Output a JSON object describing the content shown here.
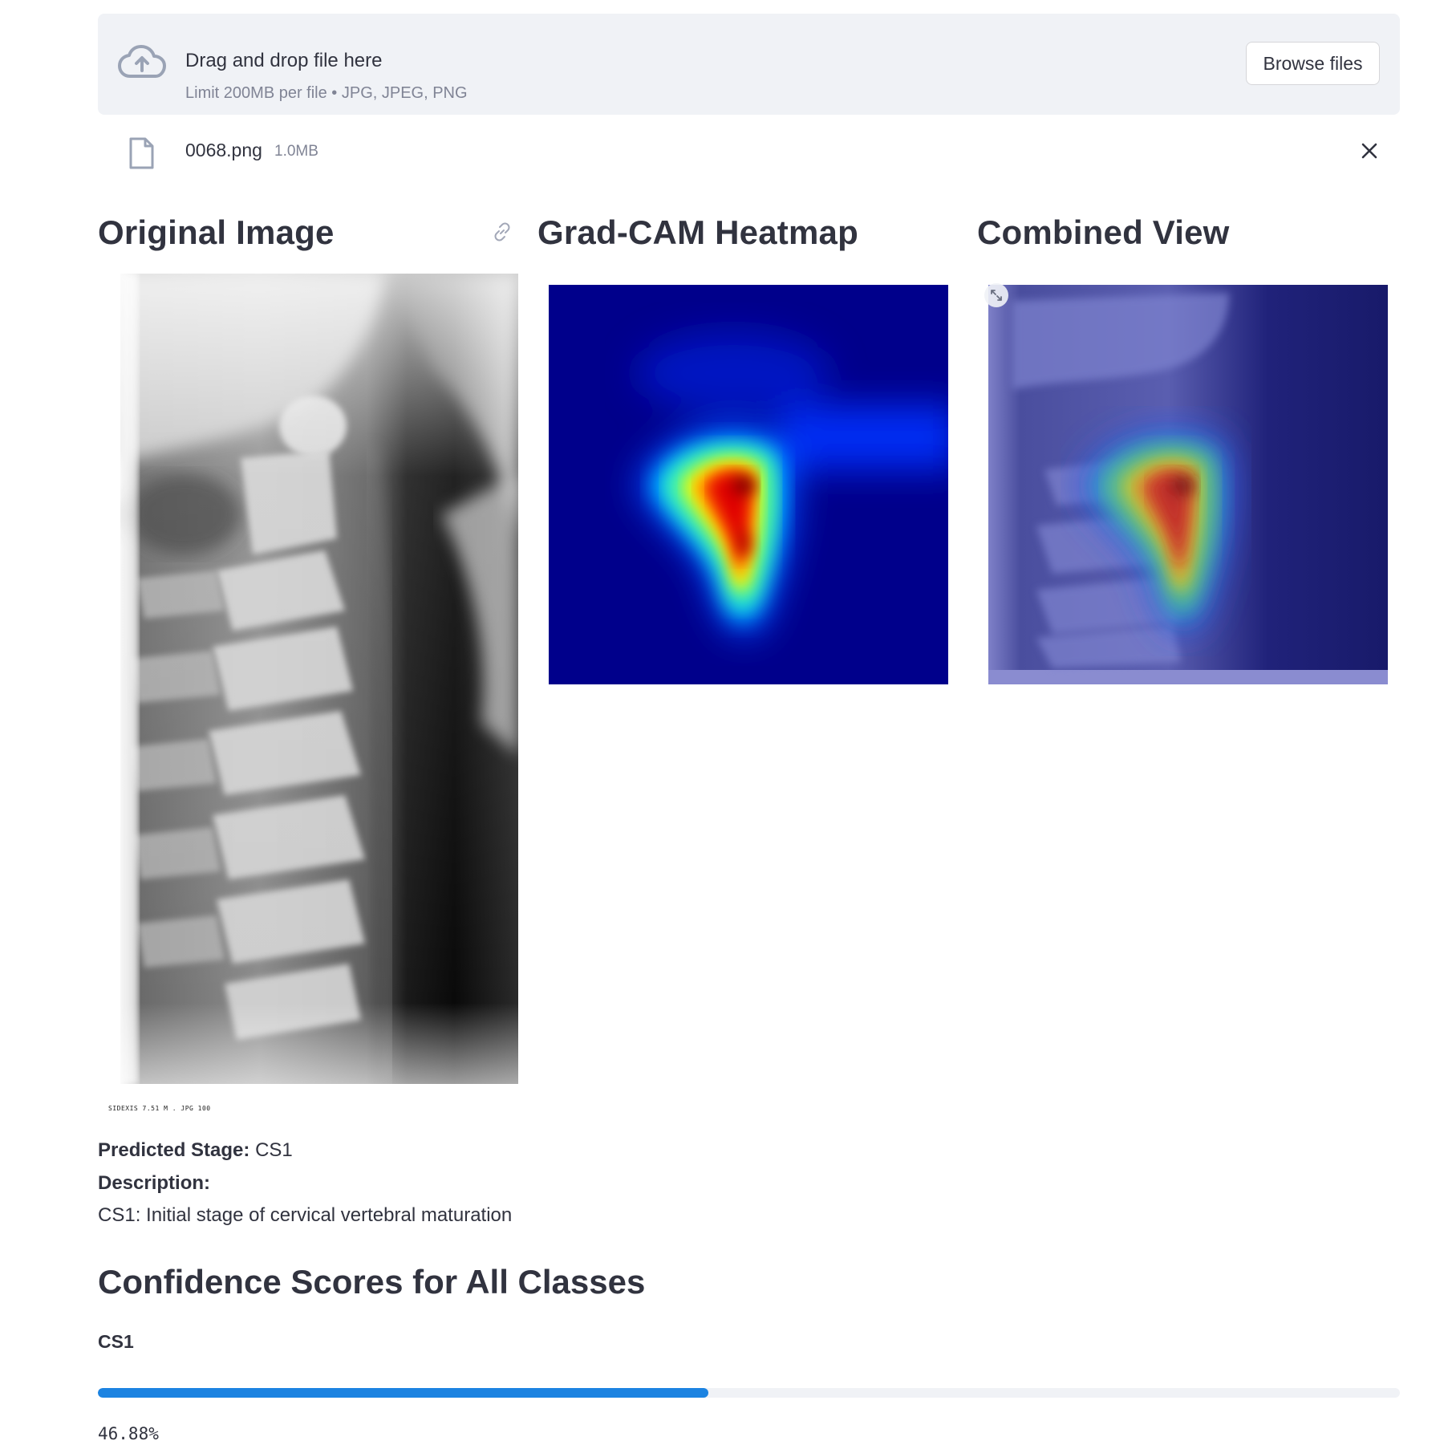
{
  "uploader": {
    "title": "Drag and drop file here",
    "subtitle": "Limit 200MB per file • JPG, JPEG, PNG",
    "browse_label": "Browse files",
    "icon": "cloud-upload-icon"
  },
  "file": {
    "name": "0068.png",
    "size": "1.0MB",
    "icon": "file-icon",
    "remove_icon": "close-icon"
  },
  "columns": {
    "original_title": "Original Image",
    "heatmap_title": "Grad-CAM Heatmap",
    "combined_title": "Combined View"
  },
  "xray_caption": "SIDEXIS  7.51 M . JPG 100",
  "prediction": {
    "stage_label": "Predicted Stage:",
    "stage_value": "CS1",
    "description_label": "Description:",
    "description_text": "CS1: Initial stage of cervical vertebral maturation"
  },
  "confidence": {
    "title": "Confidence Scores for All Classes",
    "items": [
      {
        "label": "CS1",
        "percent_text": "46.88%",
        "fraction": 0.4688
      }
    ]
  },
  "colors": {
    "accent": "#1c83e1",
    "dropzone_bg": "#f0f2f6",
    "text": "#31333f",
    "muted": "#808495"
  }
}
